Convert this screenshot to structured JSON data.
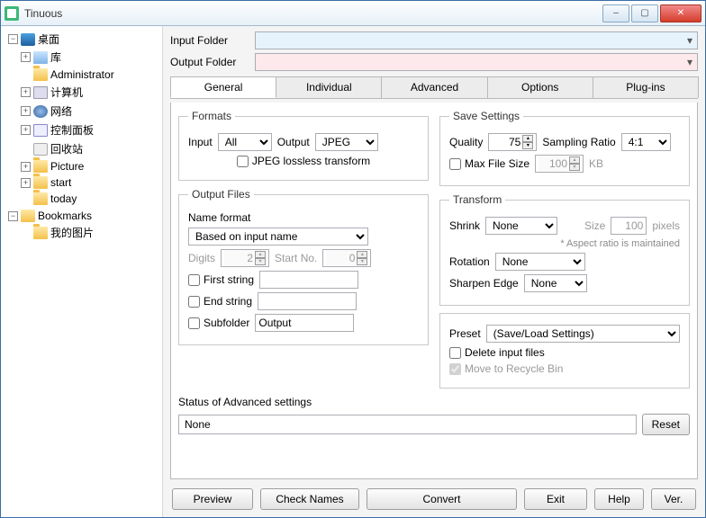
{
  "app": {
    "title": "Tinuous"
  },
  "winbtns": {
    "min": "–",
    "max": "▢",
    "close": "✕"
  },
  "tree": {
    "desktop": "桌面",
    "lib": "库",
    "admin": "Administrator",
    "computer": "计算机",
    "network": "网络",
    "control": "控制面板",
    "recycle": "回收站",
    "picture": "Picture",
    "start": "start",
    "today": "today",
    "bookmarks": "Bookmarks",
    "mypics": "我的图片"
  },
  "folders": {
    "input_label": "Input Folder",
    "output_label": "Output Folder"
  },
  "tabs": {
    "general": "General",
    "individual": "Individual",
    "advanced": "Advanced",
    "options": "Options",
    "plugins": "Plug-ins"
  },
  "formats": {
    "legend": "Formats",
    "input_label": "Input",
    "input_value": "All",
    "output_label": "Output",
    "output_value": "JPEG",
    "lossless": "JPEG lossless transform"
  },
  "save": {
    "legend": "Save Settings",
    "quality_label": "Quality",
    "quality_value": "75",
    "sampling_label": "Sampling Ratio",
    "sampling_value": "4:1",
    "maxfs": "Max File Size",
    "maxfs_value": "100",
    "kb": "KB"
  },
  "outputfiles": {
    "legend": "Output Files",
    "nameformat_label": "Name format",
    "nameformat_value": "Based on input name",
    "digits_label": "Digits",
    "digits_value": "2",
    "startno_label": "Start No.",
    "startno_value": "0",
    "first": "First string",
    "end": "End string",
    "subfolder": "Subfolder",
    "subfolder_value": "Output"
  },
  "transform": {
    "legend": "Transform",
    "shrink_label": "Shrink",
    "shrink_value": "None",
    "size_label": "Size",
    "size_value": "100",
    "pixels": "pixels",
    "aspect_note": "* Aspect ratio is maintained",
    "rotation_label": "Rotation",
    "rotation_value": "None",
    "sharpen_label": "Sharpen Edge",
    "sharpen_value": "None"
  },
  "preset": {
    "label": "Preset",
    "value": "(Save/Load Settings)",
    "delete": "Delete input files",
    "recycle": "Move to Recycle Bin"
  },
  "status": {
    "label": "Status of Advanced settings",
    "value": "None",
    "reset": "Reset"
  },
  "buttons": {
    "preview": "Preview",
    "check": "Check Names",
    "convert": "Convert",
    "exit": "Exit",
    "help": "Help",
    "ver": "Ver."
  }
}
